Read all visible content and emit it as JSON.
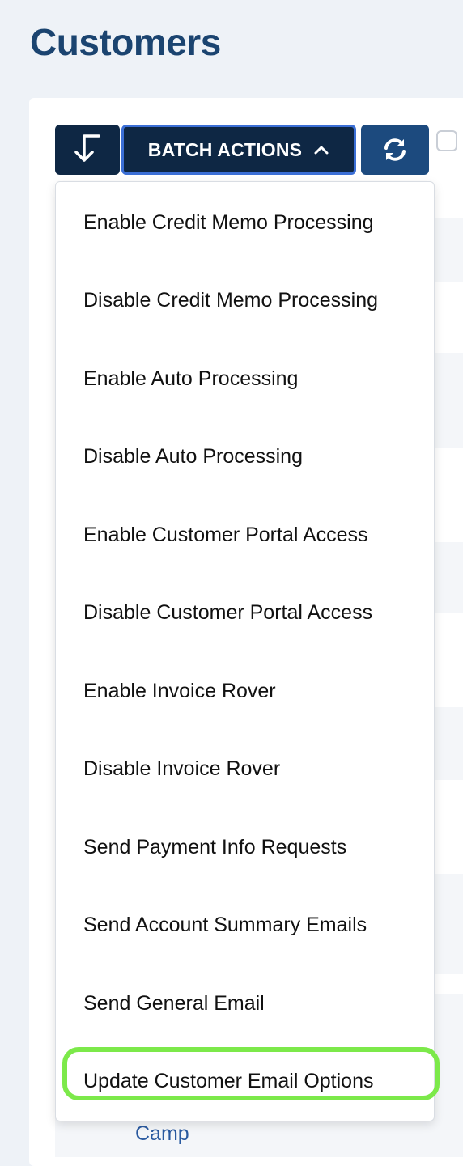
{
  "page": {
    "title": "Customers"
  },
  "toolbar": {
    "download_icon": "download-arrow-icon",
    "batch_actions_label": "BATCH ACTIONS",
    "batch_actions_icon": "chevron-up-icon",
    "refresh_icon": "refresh-icon",
    "select_all_checked": false
  },
  "batch_menu": {
    "items": [
      {
        "label": "Enable Credit Memo Processing"
      },
      {
        "label": "Disable Credit Memo Processing"
      },
      {
        "label": "Enable Auto Processing"
      },
      {
        "label": "Disable Auto Processing"
      },
      {
        "label": "Enable Customer Portal Access"
      },
      {
        "label": "Disable Customer Portal Access"
      },
      {
        "label": "Enable Invoice Rover"
      },
      {
        "label": "Disable Invoice Rover"
      },
      {
        "label": "Send Payment Info Requests"
      },
      {
        "label": "Send Account Summary Emails"
      },
      {
        "label": "Send General Email"
      },
      {
        "label": "Update Customer Email Options"
      }
    ],
    "highlighted_item": "Update Customer Email Options"
  },
  "table": {
    "peek_text": "Camp"
  },
  "colors": {
    "title": "#1b4470",
    "button_dark": "#0e2744",
    "button_focus_border": "#3b6fd6",
    "refresh_button": "#1c4a7e",
    "highlight": "#7ce94a",
    "link": "#2a5aa0"
  }
}
